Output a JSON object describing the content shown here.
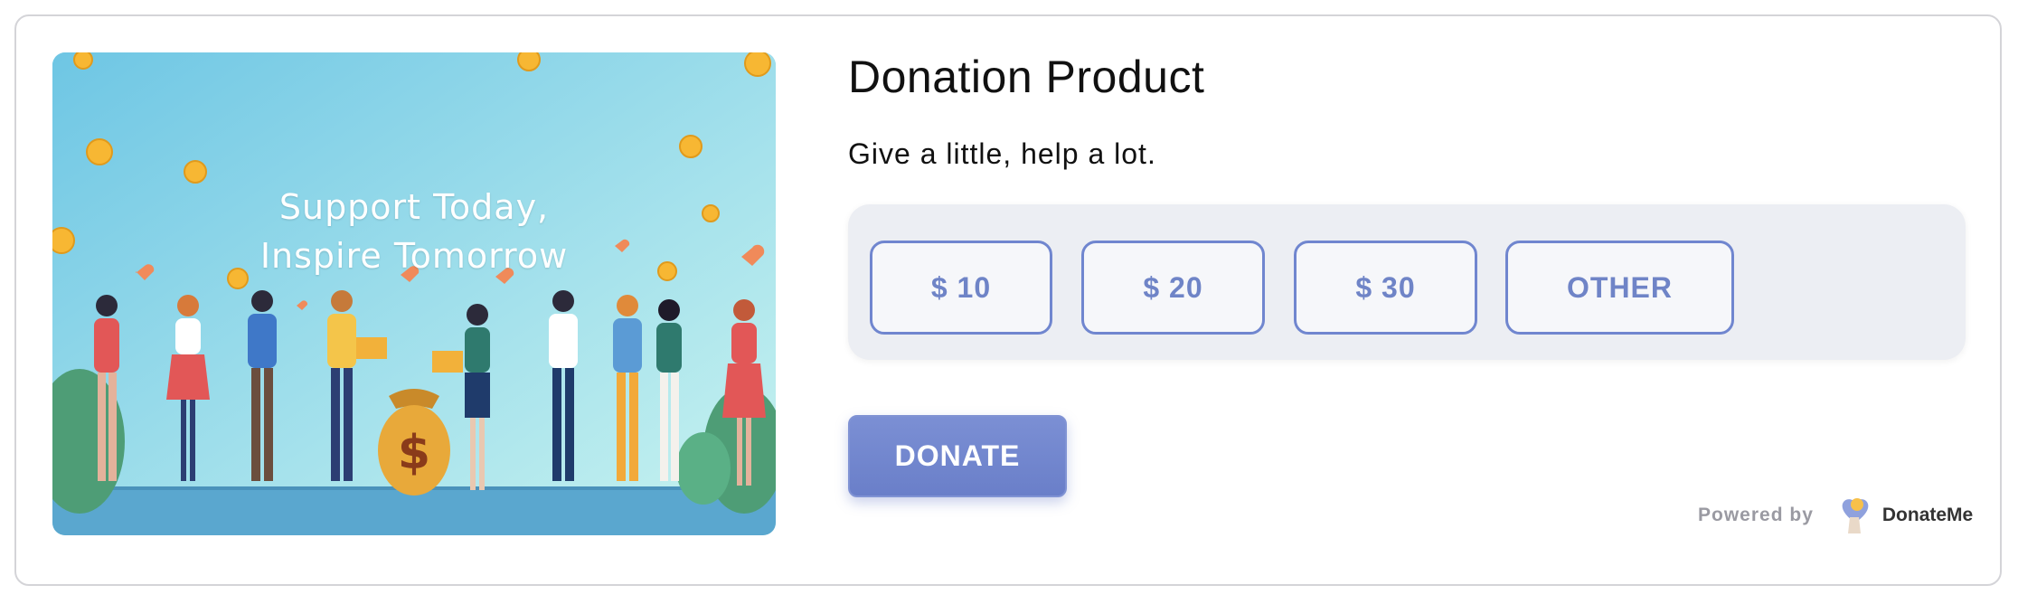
{
  "product": {
    "title": "Donation Product",
    "subtitle": "Give a little, help a lot."
  },
  "hero": {
    "line1": "Support Today,",
    "line2": "Inspire Tomorrow",
    "illustration": "group-of-people-donation-illustration"
  },
  "amounts": [
    {
      "label": "$ 10"
    },
    {
      "label": "$ 20"
    },
    {
      "label": "$ 30"
    },
    {
      "label": "OTHER"
    }
  ],
  "donate_label": "DONATE",
  "footer": {
    "powered_by": "Powered by",
    "brand": "DonateMe",
    "logo_icon": "donateme-heart-hand-icon"
  },
  "colors": {
    "accent": "#6f84c7",
    "button_fill": "#7086cf",
    "panel_bg": "#eceef3"
  }
}
